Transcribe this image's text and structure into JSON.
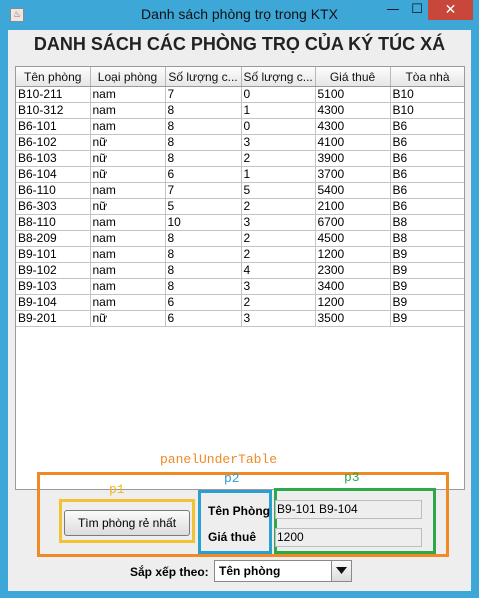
{
  "window": {
    "title": "Danh sách phòng trọ trong KTX",
    "min_glyph": "—",
    "max_glyph": "☐",
    "close_glyph": "✕",
    "app_icon_glyph": "♨"
  },
  "heading": "DANH SÁCH CÁC PHÒNG TRỌ CỦA KÝ TÚC XÁ",
  "table": {
    "columns": [
      "Tên phòng",
      "Loại phòng",
      "Số lượng c...",
      "Số lượng c...",
      "Giá thuê",
      "Tòa nhà"
    ],
    "rows": [
      [
        "B10-211",
        "nam",
        "7",
        "0",
        "5100",
        "B10"
      ],
      [
        "B10-312",
        "nam",
        "8",
        "1",
        "4300",
        "B10"
      ],
      [
        "B6-101",
        "nam",
        "8",
        "0",
        "4300",
        "B6"
      ],
      [
        "B6-102",
        "nữ",
        "8",
        "3",
        "4100",
        "B6"
      ],
      [
        "B6-103",
        "nữ",
        "8",
        "2",
        "3900",
        "B6"
      ],
      [
        "B6-104",
        "nữ",
        "6",
        "1",
        "3700",
        "B6"
      ],
      [
        "B6-110",
        "nam",
        "7",
        "5",
        "5400",
        "B6"
      ],
      [
        "B6-303",
        "nữ",
        "5",
        "2",
        "2100",
        "B6"
      ],
      [
        "B8-110",
        "nam",
        "10",
        "3",
        "6700",
        "B8"
      ],
      [
        "B8-209",
        "nam",
        "8",
        "2",
        "4500",
        "B8"
      ],
      [
        "B9-101",
        "nam",
        "8",
        "2",
        "1200",
        "B9"
      ],
      [
        "B9-102",
        "nam",
        "8",
        "4",
        "2300",
        "B9"
      ],
      [
        "B9-103",
        "nam",
        "8",
        "3",
        "3400",
        "B9"
      ],
      [
        "B9-104",
        "nam",
        "6",
        "2",
        "1200",
        "B9"
      ],
      [
        "B9-201",
        "nữ",
        "6",
        "3",
        "3500",
        "B9"
      ]
    ]
  },
  "annotations": {
    "panel_under_table": "panelUnderTable",
    "p1": "p1",
    "p2": "p2",
    "p3": "p3"
  },
  "search": {
    "button_label": "Tìm phòng rẻ nhất",
    "name_label": "Tên Phòng",
    "price_label": "Giá thuê",
    "name_value": "B9-101 B9-104",
    "price_value": "1200"
  },
  "sort": {
    "label": "Sắp xếp theo:",
    "selected": "Tên phòng"
  },
  "colors": {
    "panel_outline": "#f08a24",
    "p1_outline": "#f2c233",
    "p2_outline": "#2b9fd0",
    "p3_outline": "#2fa84a",
    "window_frame": "#3da7d8",
    "close_button": "#c7473a"
  }
}
